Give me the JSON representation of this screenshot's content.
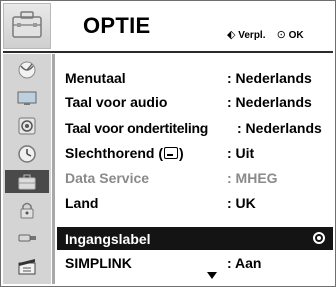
{
  "header": {
    "title": "OPTIE",
    "move_hint": "Verpl.",
    "ok_hint": "OK",
    "move_icon": "four-way-arrow-icon",
    "ok_icon": "ok-circle-icon"
  },
  "sidebar": {
    "items": [
      {
        "icon": "satellite-dish-icon",
        "active": false
      },
      {
        "icon": "tv-screen-icon",
        "active": false
      },
      {
        "icon": "speaker-icon",
        "active": false
      },
      {
        "icon": "clock-icon",
        "active": false
      },
      {
        "icon": "option-suitcase-icon",
        "active": true
      },
      {
        "icon": "lock-icon",
        "active": false
      },
      {
        "icon": "input-plug-icon",
        "active": false
      },
      {
        "icon": "clapperboard-icon",
        "active": false
      }
    ]
  },
  "menu": {
    "rows": [
      {
        "label": "Menutaal",
        "value": ": Nederlands",
        "state": "normal"
      },
      {
        "label": "Taal voor audio",
        "value": ": Nederlands",
        "state": "normal"
      },
      {
        "label": "Taal voor ondertiteling",
        "value": ": Nederlands",
        "state": "normal"
      },
      {
        "label": "Slechthorend (",
        "label_suffix": ")",
        "value": ": Uit",
        "state": "normal"
      },
      {
        "label": "Data Service",
        "value": ": MHEG",
        "state": "disabled"
      },
      {
        "label": "Land",
        "value": ": UK",
        "state": "normal"
      },
      {
        "label": "Ingangslabel",
        "value": "",
        "state": "selected"
      },
      {
        "label": "SIMPLINK",
        "value": ": Aan",
        "state": "normal"
      }
    ],
    "scroll_icon": "scroll-down-arrow-icon"
  },
  "colors": {
    "selected_bg": "#141414",
    "active_icon_bg": "#4a4a4a",
    "sidebar_bg": "#d4d4d4",
    "disabled_text": "#8a8a8a"
  }
}
